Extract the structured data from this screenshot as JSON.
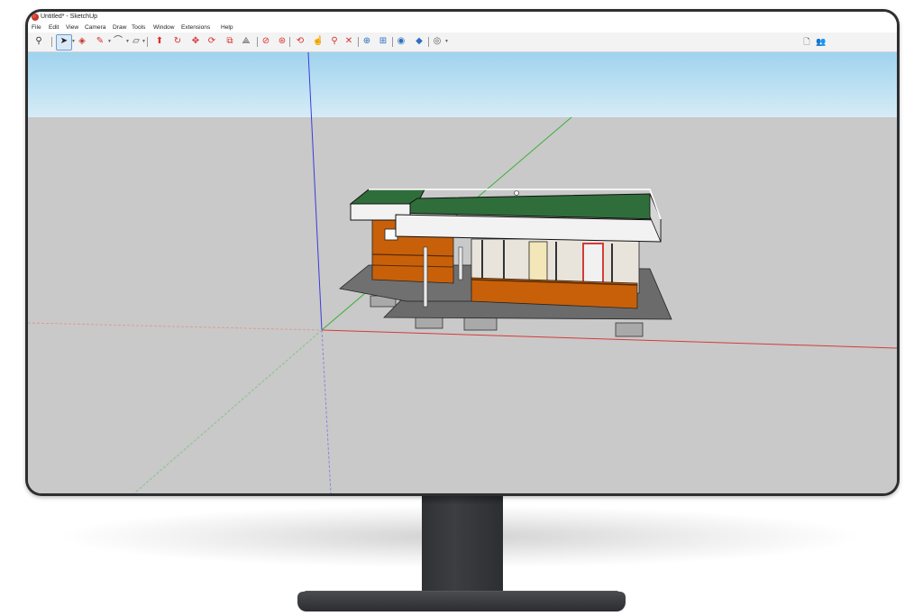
{
  "window": {
    "title": "Untitled* - SketchUp"
  },
  "menu": {
    "items": [
      "File",
      "Edit",
      "View",
      "Camera",
      "Draw",
      "Tools",
      "Window",
      "Extensions",
      "Help"
    ]
  },
  "toolbar": {
    "tools": [
      {
        "name": "search-icon",
        "glyph": "⚲",
        "color": "#333333"
      },
      {
        "name": "select-arrow-icon",
        "glyph": "➤",
        "color": "#222222",
        "selected": true
      },
      {
        "name": "eraser-icon",
        "glyph": "◈",
        "color": "#c0392b"
      },
      {
        "name": "pencil-icon",
        "glyph": "✎",
        "color": "#d93030"
      },
      {
        "name": "arc-icon",
        "glyph": "⌒",
        "color": "#444444"
      },
      {
        "name": "shape-icon",
        "glyph": "▱",
        "color": "#444444"
      },
      {
        "name": "push-pull-icon",
        "glyph": "⬆",
        "color": "#d93030"
      },
      {
        "name": "follow-me-icon",
        "glyph": "↻",
        "color": "#d93030"
      },
      {
        "name": "move-icon",
        "glyph": "✥",
        "color": "#d93030"
      },
      {
        "name": "rotate-icon",
        "glyph": "⟳",
        "color": "#d93030"
      },
      {
        "name": "scale-icon",
        "glyph": "⧉",
        "color": "#d93030"
      },
      {
        "name": "offset-icon",
        "glyph": "⟁",
        "color": "#444444"
      },
      {
        "name": "tape-measure-icon",
        "glyph": "⊘",
        "color": "#d93030"
      },
      {
        "name": "paint-bucket-icon",
        "glyph": "⊛",
        "color": "#d93030"
      },
      {
        "name": "orbit-icon",
        "glyph": "⟲",
        "color": "#d93030"
      },
      {
        "name": "pan-icon",
        "glyph": "☝",
        "color": "#d93030"
      },
      {
        "name": "zoom-icon",
        "glyph": "⚲",
        "color": "#d93030"
      },
      {
        "name": "zoom-extents-icon",
        "glyph": "✕",
        "color": "#d93030"
      },
      {
        "name": "warehouse-icon",
        "glyph": "⊕",
        "color": "#2c6fbf"
      },
      {
        "name": "extension-warehouse-icon",
        "glyph": "⊞",
        "color": "#2c6fbf"
      },
      {
        "name": "layout-icon",
        "glyph": "◉",
        "color": "#2c6fbf"
      },
      {
        "name": "components-icon",
        "glyph": "◆",
        "color": "#2c6fbf"
      },
      {
        "name": "account-icon",
        "glyph": "◎",
        "color": "#555555"
      }
    ],
    "right_tools": [
      {
        "name": "new-file-icon",
        "glyph": "🗋",
        "color": "#444444"
      },
      {
        "name": "users-icon",
        "glyph": "👥",
        "color": "#2c6fbf"
      }
    ]
  },
  "scene": {
    "sky_color": "#b7dcef",
    "ground_color": "#c8c8c8",
    "roof_color": "#2f6e3a",
    "wall_color": "#c8600a",
    "deck_color": "#6e6e6e"
  }
}
